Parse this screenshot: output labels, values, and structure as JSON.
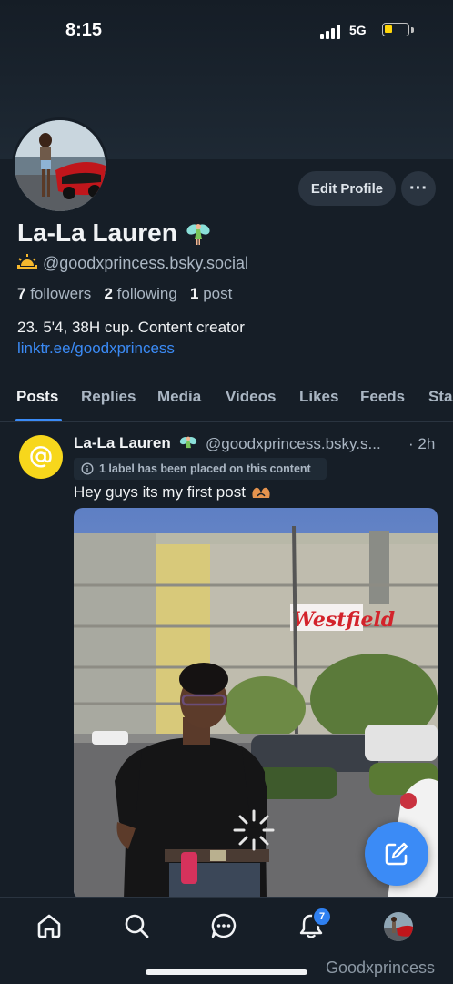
{
  "status_bar": {
    "time": "8:15",
    "network": "5G",
    "battery_level": 0.25
  },
  "profile": {
    "display_name": "La-La Lauren",
    "name_emoji": "fairy-icon",
    "handle_emoji": "sunrise-icon",
    "handle": "@goodxprincess.bsky.social",
    "followers_count": "7",
    "followers_label": "followers",
    "following_count": "2",
    "following_label": "following",
    "posts_count": "1",
    "posts_label": "post",
    "bio": "23. 5'4, 38H cup. Content creator",
    "link": "linktr.ee/goodxprincess",
    "edit_label": "Edit Profile",
    "more_label": "···"
  },
  "tabs": [
    {
      "label": "Posts",
      "active": true
    },
    {
      "label": "Replies",
      "active": false
    },
    {
      "label": "Media",
      "active": false
    },
    {
      "label": "Videos",
      "active": false
    },
    {
      "label": "Likes",
      "active": false
    },
    {
      "label": "Feeds",
      "active": false
    },
    {
      "label": "Sta",
      "active": false
    }
  ],
  "post": {
    "author": "La-La Lauren",
    "handle": "@goodxprincess.bsky.s...",
    "time": "· 2h",
    "label_notice": "1 label has been placed on this content",
    "text": "Hey guys its my first post"
  },
  "nav": {
    "notifications_badge": "7"
  },
  "watermark": "Goodxprincess",
  "colors": {
    "background": "#161e27",
    "accent": "#3b8bf6",
    "secondary_text": "#aab6c3",
    "button_bg": "#2a3440"
  }
}
